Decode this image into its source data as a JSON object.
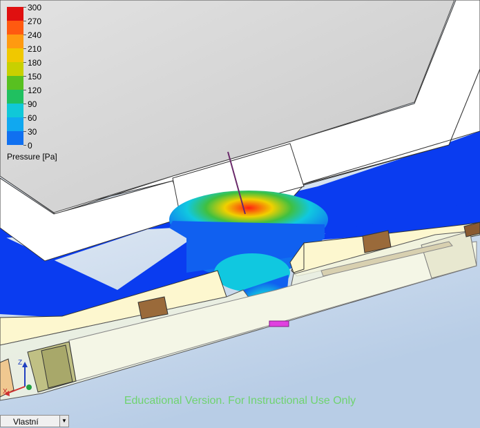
{
  "legend": {
    "title": "Pressure [Pa]",
    "ticks": [
      "300",
      "270",
      "240",
      "210",
      "180",
      "150",
      "120",
      "90",
      "60",
      "30",
      "0"
    ],
    "colors": [
      "#e01010",
      "#ff5a10",
      "#ff9a10",
      "#f0c800",
      "#c8d000",
      "#58c020",
      "#20c060",
      "#10c8d8",
      "#10a8f0",
      "#1070f0",
      "#0020e0"
    ]
  },
  "watermark": "Educational Version. For Instructional Use Only",
  "view_selector": {
    "value": "Vlastní"
  },
  "triad": {
    "x_label": "X",
    "z_label": "Z"
  },
  "colors": {
    "part_gray": "#d6d6d6",
    "part_white": "#ffffff",
    "fluid_low": "#0a3cf0",
    "cream": "#fdf7cf",
    "outlet_magenta": "#e040e0"
  }
}
